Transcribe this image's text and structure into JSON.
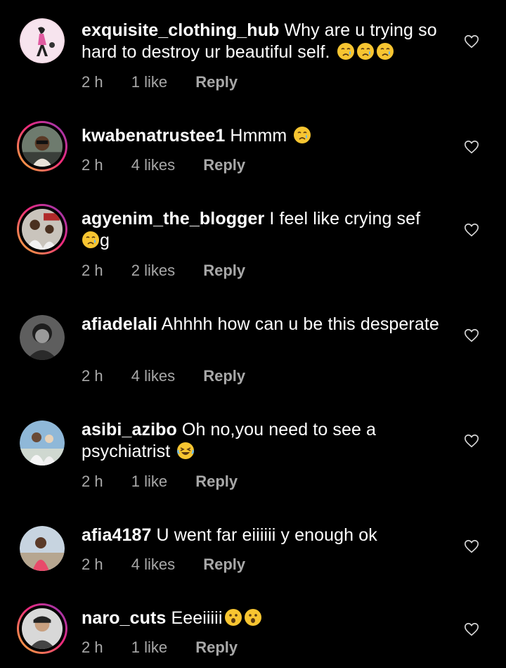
{
  "comments": [
    {
      "username": "exquisite_clothing_hub",
      "text": "Why are u trying so hard to destroy ur beautiful self.",
      "emojis": [
        "crying-face",
        "crying-face",
        "crying-face"
      ],
      "time": "2 h",
      "likes": "1 like",
      "reply": "Reply"
    },
    {
      "username": "kwabenatrustee1",
      "text": "Hmmm",
      "emojis": [
        "crying-face"
      ],
      "time": "2 h",
      "likes": "4 likes",
      "reply": "Reply"
    },
    {
      "username": "agyenim_the_blogger",
      "text": "I feel like crying sef",
      "text_after": "g",
      "emojis": [
        "crying-face"
      ],
      "time": "2 h",
      "likes": "2 likes",
      "reply": "Reply"
    },
    {
      "username": "afiadelali",
      "text": "Ahhhh how can u be this desperate",
      "emojis": [],
      "time": "2 h",
      "likes": "4 likes",
      "reply": "Reply"
    },
    {
      "username": "asibi_azibo",
      "text": "Oh no,you need to see a psychiatrist",
      "emojis": [
        "laughing-face"
      ],
      "time": "2 h",
      "likes": "1 like",
      "reply": "Reply"
    },
    {
      "username": "afia4187",
      "text": "U went far eiiiiii y enough ok",
      "emojis": [],
      "time": "2 h",
      "likes": "4 likes",
      "reply": "Reply"
    },
    {
      "username": "naro_cuts",
      "text": "Eeeiiiii",
      "emojis": [
        "hushed-face",
        "hushed-face"
      ],
      "time": "2 h",
      "likes": "1 like",
      "reply": "Reply"
    }
  ],
  "icons": {
    "like": "heart-outline-icon"
  },
  "colors": {
    "background": "#000000",
    "text": "#ffffff",
    "meta": "#a8a8a8",
    "emoji": "#f7c531"
  }
}
